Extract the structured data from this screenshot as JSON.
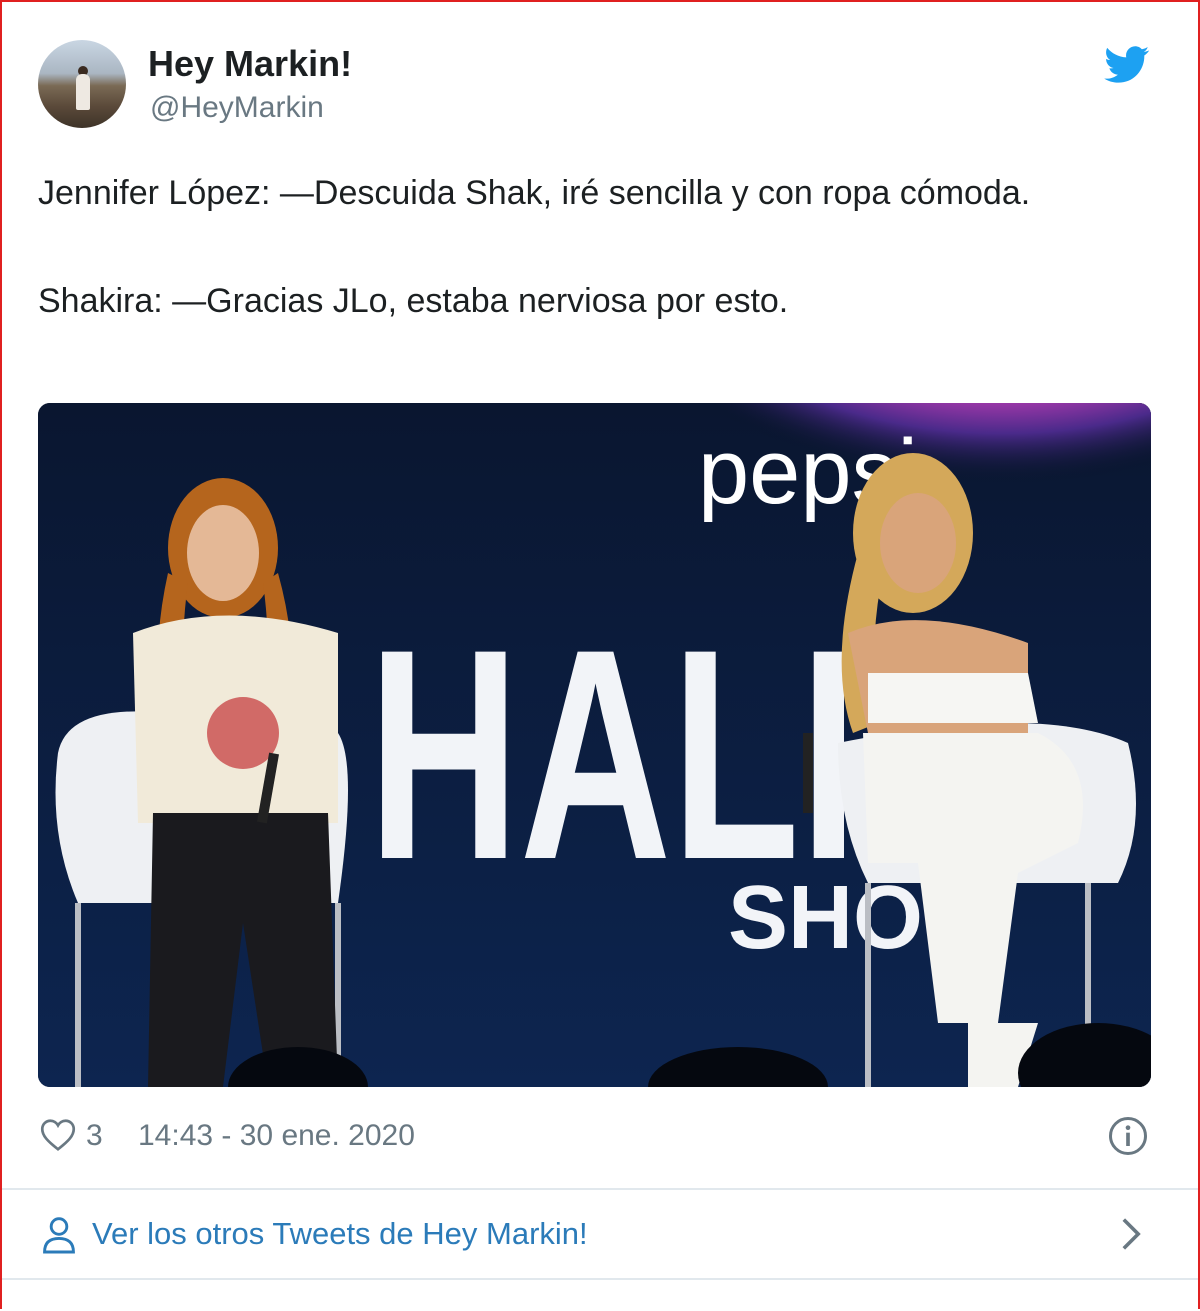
{
  "tweet": {
    "author_name": "Hey Markin!",
    "author_handle": "@HeyMarkin",
    "text_line1": "Jennifer López: —Descuida Shak, iré sencilla y con ropa cómoda.",
    "text_line2": "Shakira: —Gracias JLo, estaba nerviosa por esto.",
    "photo": {
      "sign_text_brand": "pepsi",
      "sign_text_main": "HALF",
      "sign_text_sub": "SHO"
    },
    "likes": "3",
    "timestamp": "14:43 - 30 ene. 2020",
    "more_link": "Ver los otros Tweets de Hey Markin!"
  },
  "icons": {
    "bird": "twitter-bird-icon",
    "heart": "heart-icon",
    "info": "info-icon",
    "person": "person-icon",
    "chevron": "chevron-right-icon"
  },
  "colors": {
    "twitter_blue": "#1da1f2",
    "link_blue": "#2b7bb9",
    "muted": "#697882",
    "border_red": "#e02020"
  }
}
